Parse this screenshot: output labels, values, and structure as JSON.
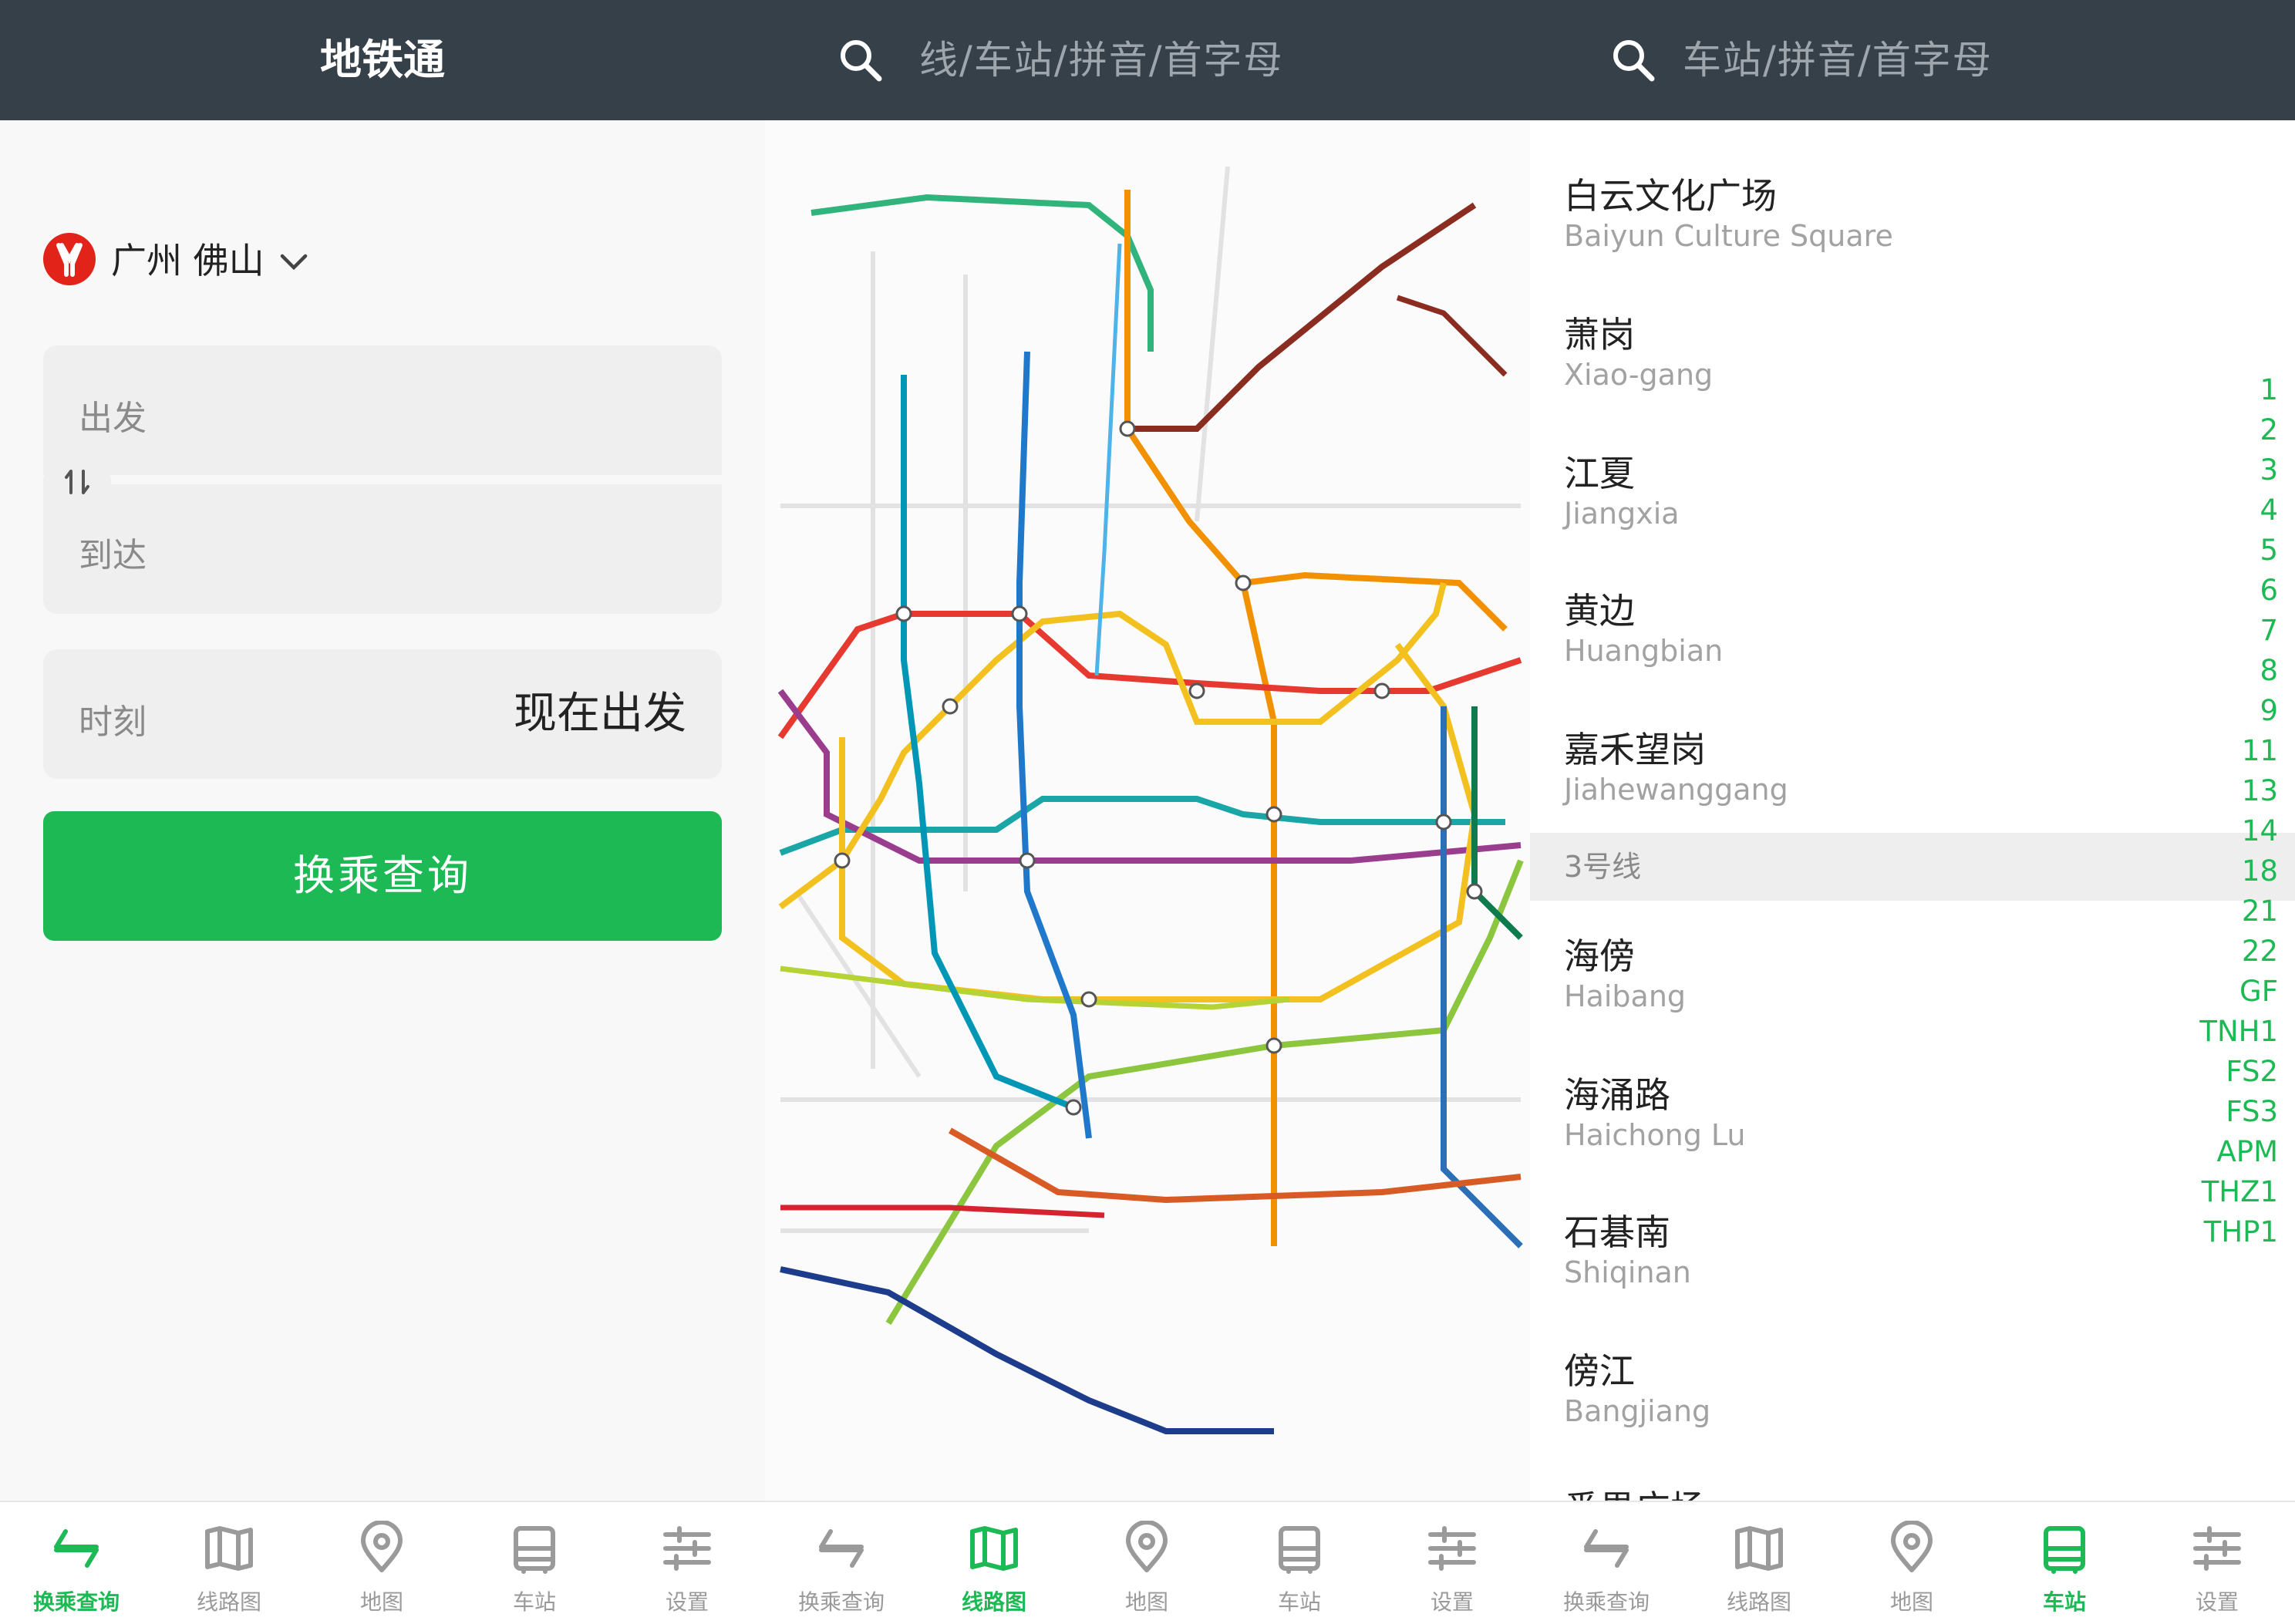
{
  "panel1": {
    "title": "地铁通",
    "city": "广州 佛山",
    "origin_label": "出发",
    "dest_label": "到达",
    "time_label": "时刻",
    "time_value": "现在出发",
    "query_button": "换乘查询"
  },
  "panel2": {
    "search_placeholder": "线/车站/拼音/首字母"
  },
  "panel3": {
    "search_placeholder": "车站/拼音/首字母",
    "stations_top": [
      {
        "cn": "白云文化广场",
        "en": "Baiyun Culture Square"
      },
      {
        "cn": "萧岗",
        "en": "Xiao-gang"
      },
      {
        "cn": "江夏",
        "en": "Jiangxia"
      },
      {
        "cn": "黄边",
        "en": "Huangbian"
      },
      {
        "cn": "嘉禾望岗",
        "en": "Jiahewanggang"
      }
    ],
    "section": "3号线",
    "stations_bottom": [
      {
        "cn": "海傍",
        "en": "Haibang"
      },
      {
        "cn": "海涌路",
        "en": "Haichong Lu"
      },
      {
        "cn": "石碁南",
        "en": "Shiqinan"
      },
      {
        "cn": "傍江",
        "en": "Bangjiang"
      },
      {
        "cn": "番禺广场",
        "en": ""
      }
    ],
    "index": [
      "1",
      "2",
      "3",
      "4",
      "5",
      "6",
      "7",
      "8",
      "9",
      "11",
      "13",
      "14",
      "18",
      "21",
      "22",
      "GF",
      "TNH1",
      "FS2",
      "FS3",
      "APM",
      "THZ1",
      "THP1"
    ]
  },
  "nav": [
    "换乘查询",
    "线路图",
    "地图",
    "车站",
    "设置"
  ],
  "colors": {
    "accent": "#1db954",
    "topbar": "#364049",
    "brand_red": "#e2231a"
  }
}
